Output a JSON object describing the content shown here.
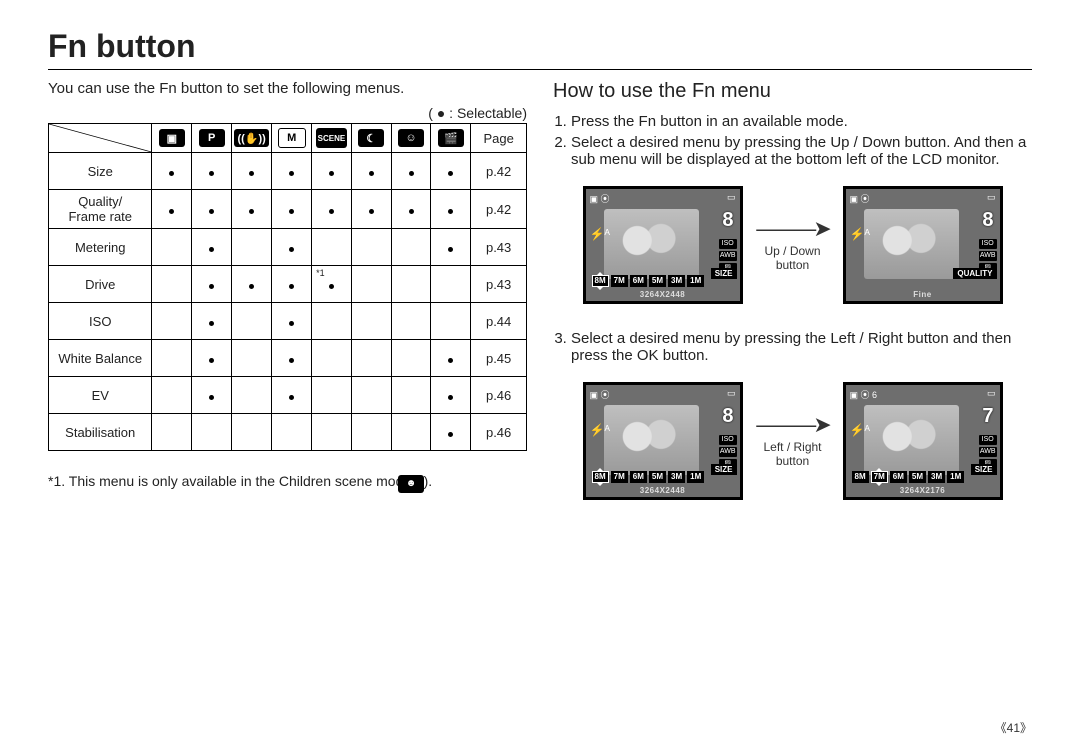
{
  "title": "Fn button",
  "intro": "You can use the Fn button to set the following menus.",
  "legend": "( ● : Selectable)",
  "table": {
    "modes": [
      {
        "name": "auto",
        "label": "▣",
        "style": "mode-dark"
      },
      {
        "name": "program",
        "label": "P",
        "style": "mode-dark"
      },
      {
        "name": "dis",
        "label": "((✋))",
        "style": "mode-dark"
      },
      {
        "name": "manual",
        "label": "M",
        "style": "mode-light"
      },
      {
        "name": "scene",
        "label": "SCENE",
        "style": "mode-dark"
      },
      {
        "name": "night",
        "label": "☾",
        "style": "mode-dark"
      },
      {
        "name": "portrait",
        "label": "☺",
        "style": "mode-dark"
      },
      {
        "name": "movie",
        "label": "🎬",
        "style": "mode-dark"
      }
    ],
    "page_col": "Page",
    "rows": [
      {
        "name": "Size",
        "dots": [
          1,
          1,
          1,
          1,
          1,
          1,
          1,
          1
        ],
        "page": "p.42"
      },
      {
        "name": "Quality/\nFrame rate",
        "dots": [
          1,
          1,
          1,
          1,
          1,
          1,
          1,
          1
        ],
        "page": "p.42"
      },
      {
        "name": "Metering",
        "dots": [
          0,
          1,
          0,
          1,
          0,
          0,
          0,
          1
        ],
        "page": "p.43"
      },
      {
        "name": "Drive",
        "dots": [
          0,
          1,
          1,
          1,
          "*1",
          0,
          0,
          0
        ],
        "page": "p.43"
      },
      {
        "name": "ISO",
        "dots": [
          0,
          1,
          0,
          1,
          0,
          0,
          0,
          0
        ],
        "page": "p.44"
      },
      {
        "name": "White Balance",
        "dots": [
          0,
          1,
          0,
          1,
          0,
          0,
          0,
          1
        ],
        "page": "p.45",
        "small": true
      },
      {
        "name": "EV",
        "dots": [
          0,
          1,
          0,
          1,
          0,
          0,
          0,
          1
        ],
        "page": "p.46"
      },
      {
        "name": "Stabilisation",
        "dots": [
          0,
          0,
          0,
          0,
          0,
          0,
          0,
          1
        ],
        "page": "p.46"
      }
    ]
  },
  "footnote": "*1. This menu is only available in the Children scene mode (        ).",
  "right": {
    "heading": "How to use the Fn menu",
    "step1": "Press the Fn button in an available mode.",
    "step2": "Select a desired menu by pressing the Up / Down button. And then a sub menu will be displayed at the bottom left of the LCD monitor.",
    "step3": "Select a desired menu by pressing the Left / Right button and then press the OK button.",
    "caption1": "Up / Down button",
    "caption2": "Left / Right button",
    "lcd": {
      "big_icon": "8",
      "size_label": "SIZE",
      "quality_label": "QUALITY",
      "iso": "ISO",
      "awb": "AWB",
      "fine": "Fine",
      "thumbs": [
        "8M",
        "7M",
        "6M",
        "5M",
        "3M",
        "1M"
      ],
      "res1": "3264X2448",
      "res2": "3264X2176"
    }
  },
  "page_number": "《41》"
}
